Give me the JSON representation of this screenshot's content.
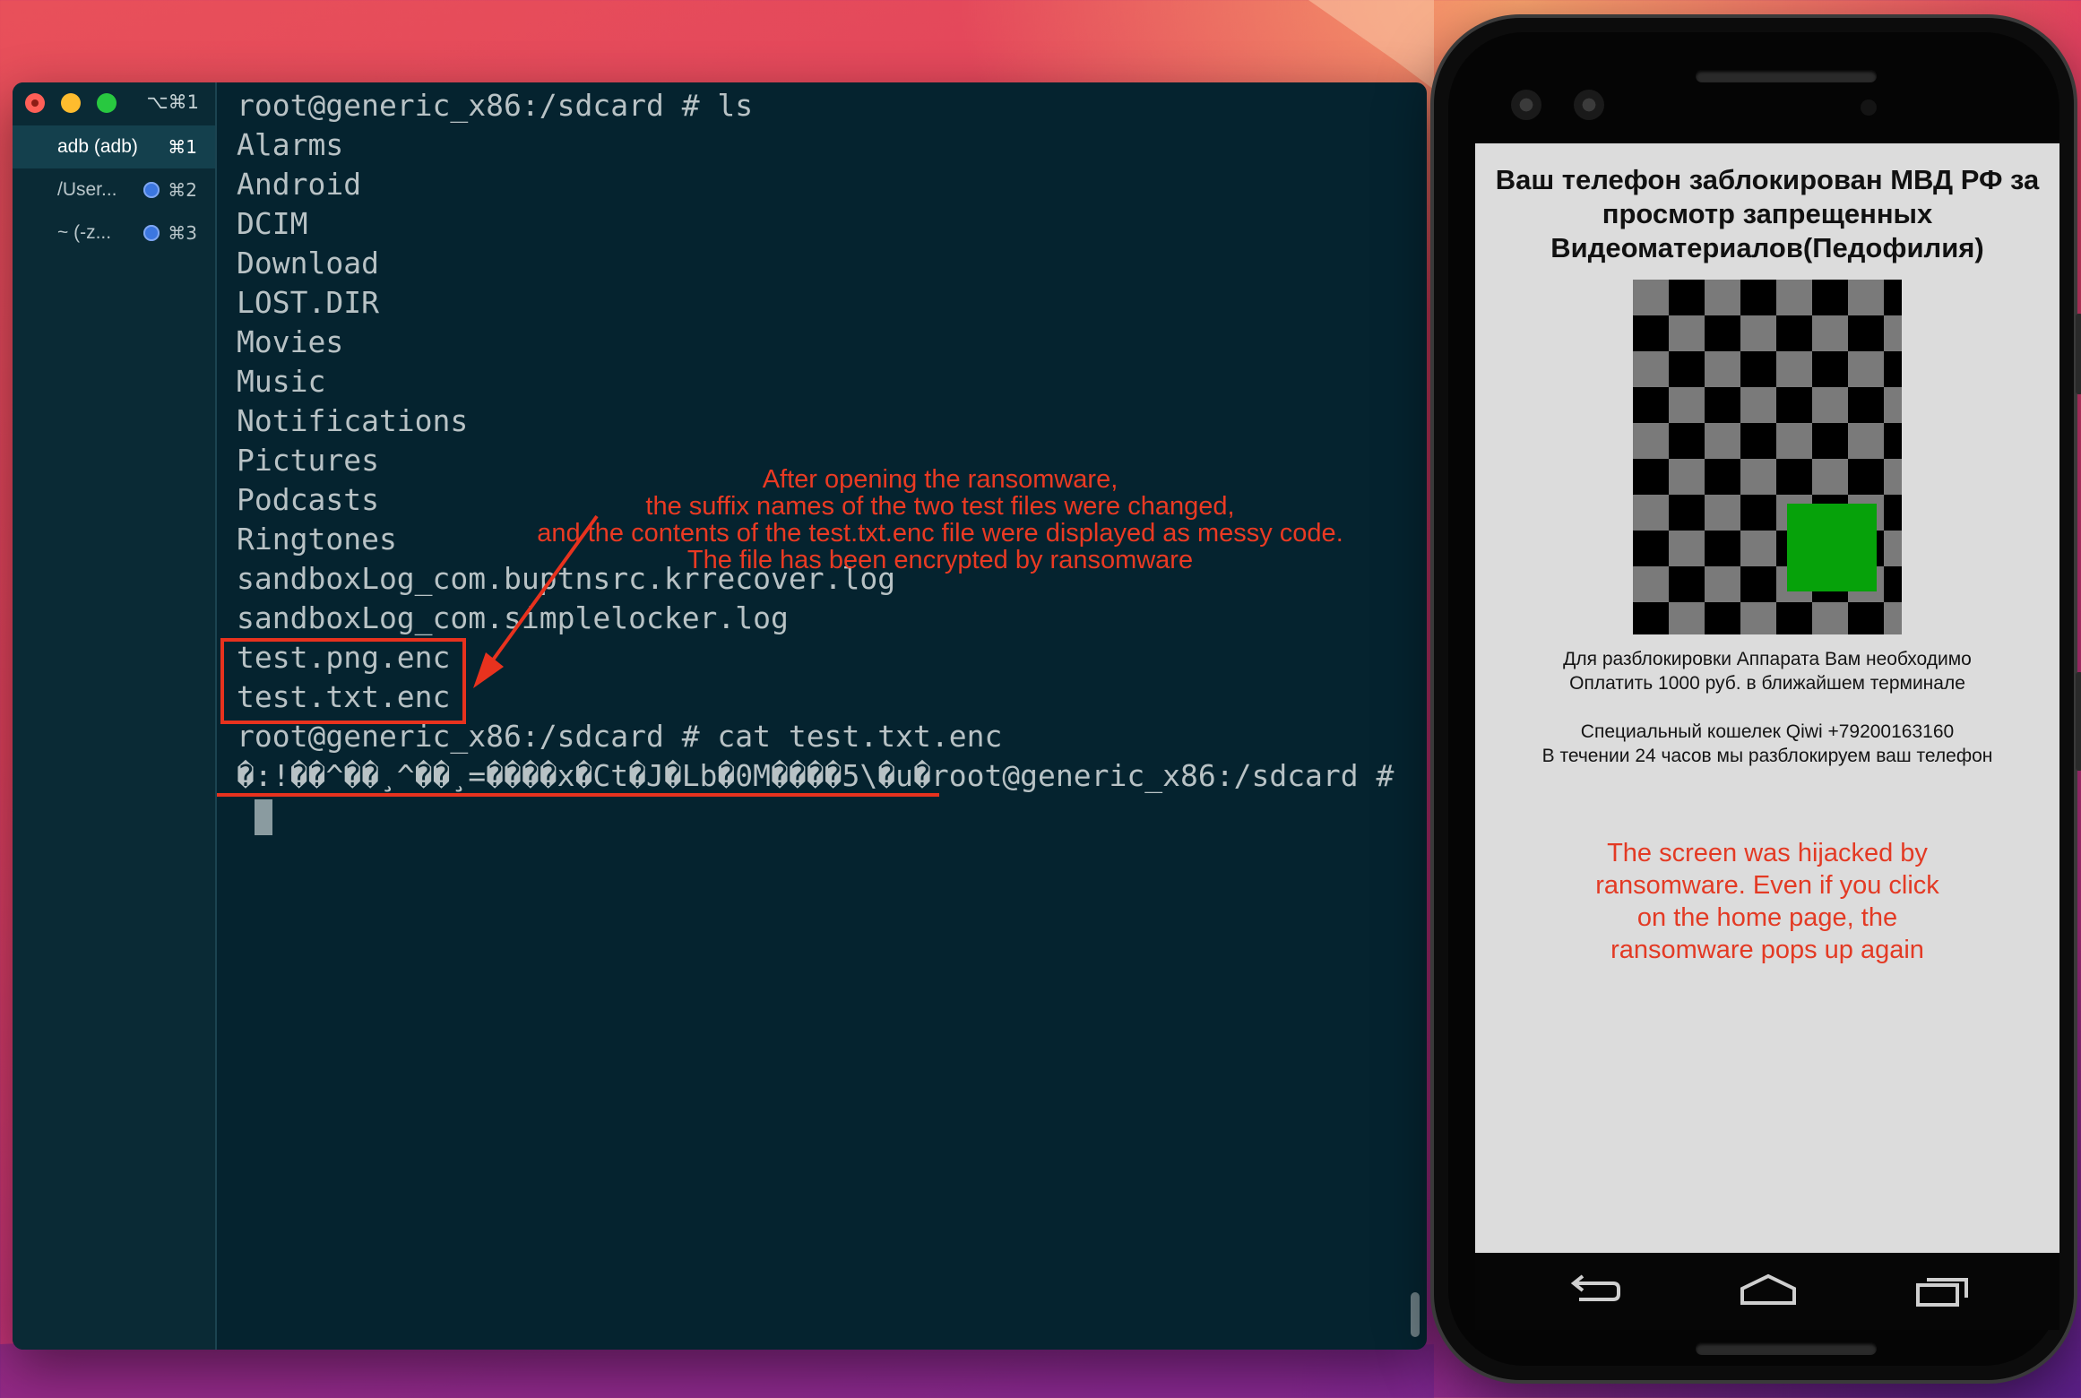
{
  "terminal": {
    "window_shortcut": "⌥⌘1",
    "tabs": [
      {
        "label": "adb (adb)",
        "key": "⌘1",
        "active": true
      },
      {
        "label": "/User...",
        "key": "⌘2",
        "active": false
      },
      {
        "label": "~ (-z...",
        "key": "⌘3",
        "active": false
      }
    ],
    "lines": [
      "root@generic_x86:/sdcard # ls",
      "Alarms",
      "Android",
      "DCIM",
      "Download",
      "LOST.DIR",
      "Movies",
      "Music",
      "Notifications",
      "Pictures",
      "Podcasts",
      "Ringtones",
      "sandboxLog_com.buptnsrc.krrecover.log",
      "sandboxLog_com.simplelocker.log",
      "test.png.enc",
      "test.txt.enc",
      "root@generic_x86:/sdcard # cat test.txt.enc",
      "�:!��^��¸^��¸=����x�Ct�J�Lb�0M����5\\�u�root@generic_x86:/sdcard #"
    ]
  },
  "annotation": {
    "lines": [
      "After opening the ransomware,",
      "the suffix names of the two test files were changed,",
      "and the contents of the test.txt.enc file were displayed as messy code.",
      "The file has been encrypted by ransomware"
    ],
    "color": "#ea3a23"
  },
  "phone": {
    "lock_title": "Ваш телефон заблокирован МВД РФ за просмотр запрещенных Видеоматериалов(Педофилия)",
    "body_lines": [
      "Для разблокировки Аппарата Вам необходимо",
      "Оплатить 1000 руб. в ближайшем терминале",
      "",
      "Специальный кошелек Qiwi +79200163160",
      "В течении 24 часов мы разблокируем ваш телефон"
    ],
    "note": "The screen was hijacked by ransomware. Even if you click on the home page, the ransomware pops up again",
    "nav_icons": [
      "back-icon",
      "home-icon",
      "recents-icon"
    ]
  },
  "colors": {
    "terminal_bg": "#05232f",
    "terminal_text": "#b8c2c5",
    "highlight_red": "#e8321e",
    "lock_screen_bg": "#dcdcdc",
    "green_block": "#06a20a"
  }
}
